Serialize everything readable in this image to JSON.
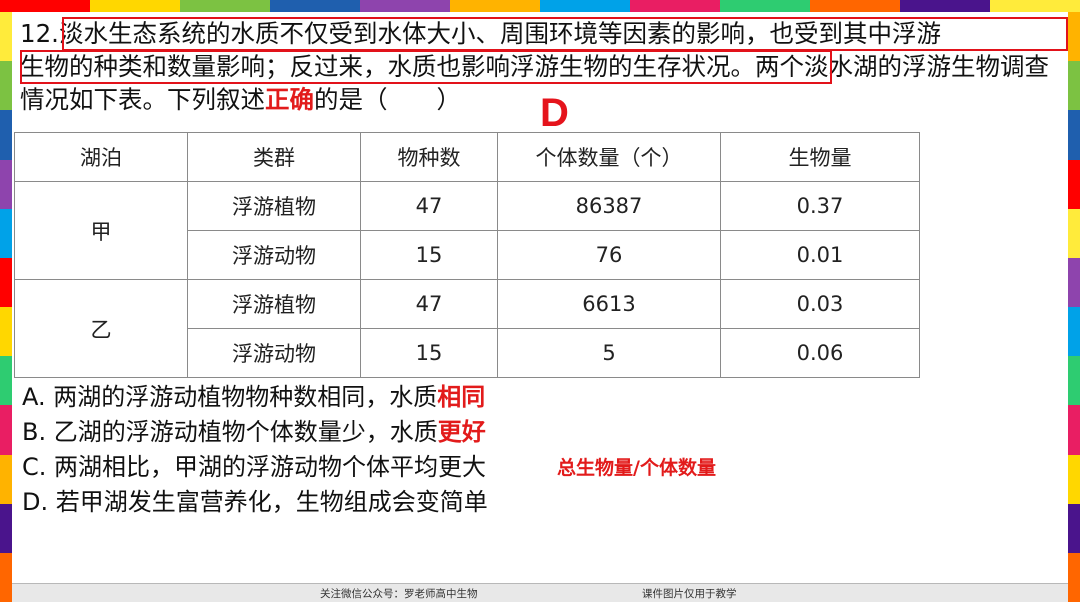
{
  "question": {
    "number": "12.",
    "boxed_line1": "淡水生态系统的水质不仅受到水体大小、周围环境等因素的影响，也受到其中浮游",
    "boxed_line2": "生物的种类和数量影响；反过来，水质也影响浮游生物的生存状况。",
    "tail": "两个淡水湖的浮游生物调查情况如下表。下列叙述",
    "highlight": "正确",
    "ending": "的是（　　）",
    "answer": "D"
  },
  "table": {
    "headers": [
      "湖泊",
      "类群",
      "物种数",
      "个体数量（个）",
      "生物量"
    ],
    "lakes": [
      {
        "name": "甲",
        "rows": [
          {
            "group": "浮游植物",
            "species": "47",
            "count": "86387",
            "biomass": "0.37"
          },
          {
            "group": "浮游动物",
            "species": "15",
            "count": "76",
            "biomass": "0.01"
          }
        ]
      },
      {
        "name": "乙",
        "rows": [
          {
            "group": "浮游植物",
            "species": "47",
            "count": "6613",
            "biomass": "0.03"
          },
          {
            "group": "浮游动物",
            "species": "15",
            "count": "5",
            "biomass": "0.06"
          }
        ]
      }
    ]
  },
  "options": {
    "A": {
      "text": "A. 两湖的浮游动植物物种数相同，水质",
      "hl": "相同"
    },
    "B": {
      "text": "B. 乙湖的浮游动植物个体数量少，水质",
      "hl": "更好"
    },
    "C": {
      "text": "C. 两湖相比，甲湖的浮游动物个体平均更大"
    },
    "D": {
      "text": "D. 若甲湖发生富营养化，生物组成会变简单"
    }
  },
  "annotation": "总生物量/个体数量",
  "footer": {
    "left": "关注微信公众号：罗老师高中生物",
    "right": "课件图片仅用于教学"
  },
  "colors": {
    "accent_red": "#e21b1b",
    "frame": [
      "#ff0000",
      "#ffd700",
      "#7cc242",
      "#1f5fae",
      "#8e44ad",
      "#ffb300",
      "#00a2e8",
      "#e91e63",
      "#2ecc71",
      "#ff6600",
      "#4a148c",
      "#ffeb3b"
    ]
  }
}
